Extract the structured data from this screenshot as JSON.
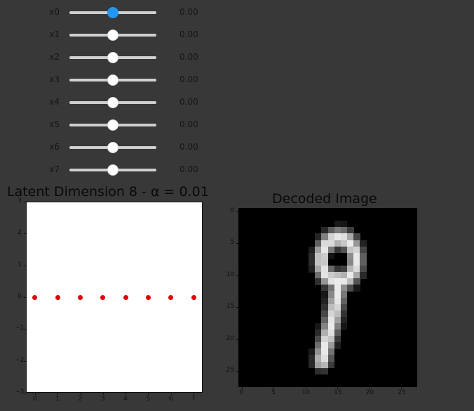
{
  "sliders": [
    {
      "label": "x0",
      "value": 0.0,
      "value_text": "0.00",
      "active": true
    },
    {
      "label": "x1",
      "value": 0.0,
      "value_text": "0.00",
      "active": false
    },
    {
      "label": "x2",
      "value": 0.0,
      "value_text": "0.00",
      "active": false
    },
    {
      "label": "x3",
      "value": 0.0,
      "value_text": "0.00",
      "active": false
    },
    {
      "label": "x4",
      "value": 0.0,
      "value_text": "0.00",
      "active": false
    },
    {
      "label": "x5",
      "value": 0.0,
      "value_text": "0.00",
      "active": false
    },
    {
      "label": "x6",
      "value": 0.0,
      "value_text": "0.00",
      "active": false
    },
    {
      "label": "x7",
      "value": 0.0,
      "value_text": "0.00",
      "active": false
    }
  ],
  "slider_range": [
    -1,
    1
  ],
  "colors": {
    "background": "#383838",
    "active_knob": "#2196f3",
    "point": "#e00000"
  },
  "chart_data": [
    {
      "type": "scatter",
      "title": "Latent Dimension 8 - α = 0.01",
      "x": [
        0,
        1,
        2,
        3,
        4,
        5,
        6,
        7
      ],
      "y": [
        0,
        0,
        0,
        0,
        0,
        0,
        0,
        0
      ],
      "xticks": [
        "0",
        "1",
        "2",
        "3",
        "4",
        "5",
        "6",
        "7"
      ],
      "yticks": [
        "3",
        "2",
        "1",
        "0",
        "−1",
        "−2",
        "−3"
      ],
      "xlim": [
        -0.4,
        7.4
      ],
      "ylim": [
        -3,
        3
      ],
      "grid": false
    },
    {
      "type": "heatmap",
      "title": "Decoded Image",
      "xticks": [
        "0",
        "5",
        "10",
        "15",
        "20",
        "25"
      ],
      "yticks": [
        "0",
        "5",
        "10",
        "15",
        "20",
        "25"
      ],
      "colormap": "gray",
      "size": [
        28,
        28
      ]
    }
  ]
}
